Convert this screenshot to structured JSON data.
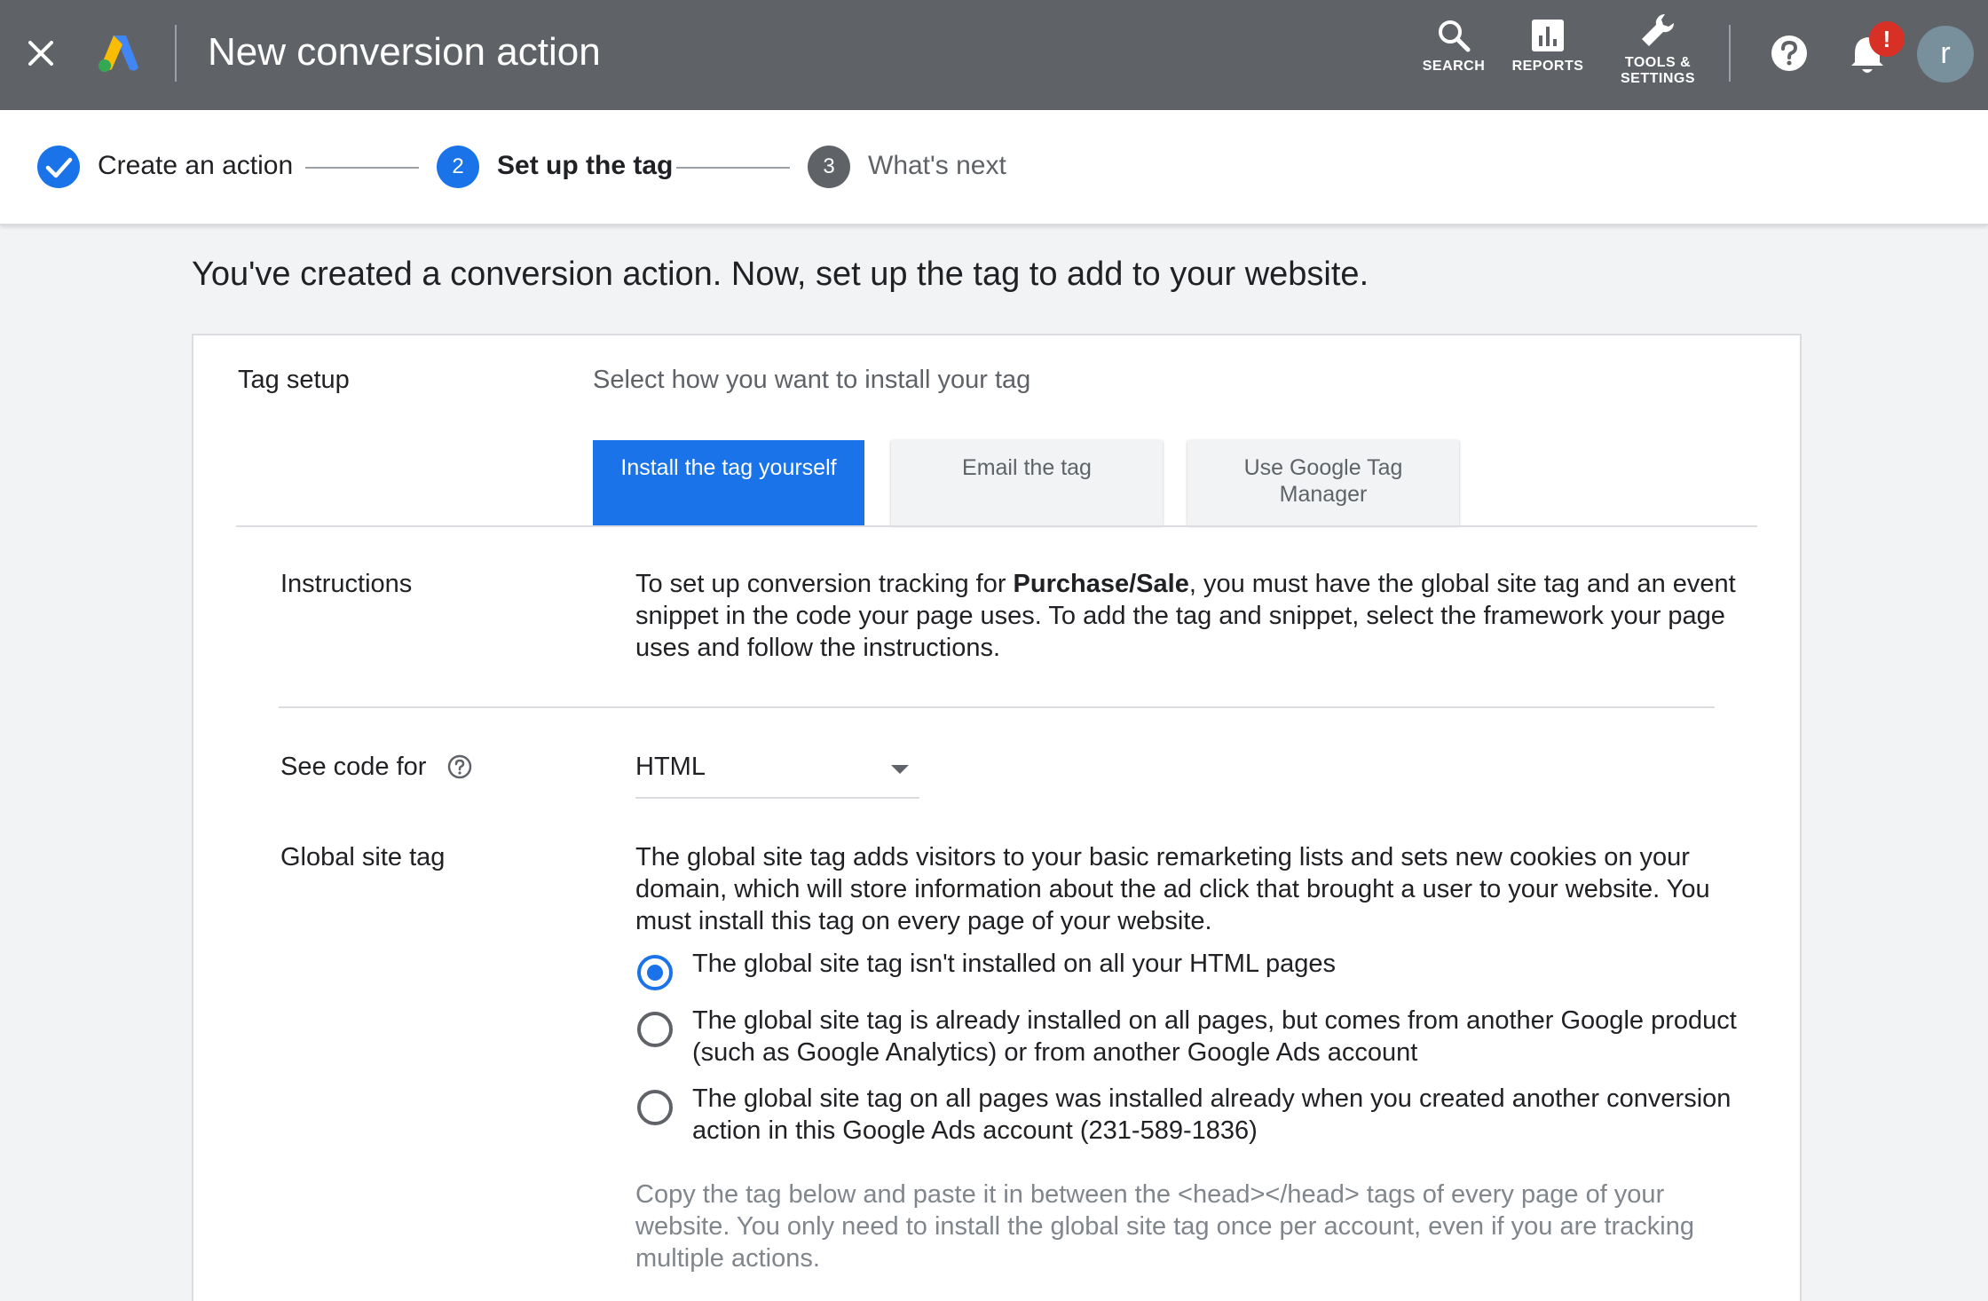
{
  "header": {
    "title": "New conversion action",
    "search_label": "SEARCH",
    "reports_label": "REPORTS",
    "tools_label_1": "TOOLS &",
    "tools_label_2": "SETTINGS",
    "notification_badge": "!",
    "avatar_initial": "r"
  },
  "stepper": {
    "steps": [
      {
        "label": "Create an action",
        "state": "done"
      },
      {
        "number": "2",
        "label": "Set up the tag",
        "state": "active"
      },
      {
        "number": "3",
        "label": "What's next",
        "state": "upcoming"
      }
    ]
  },
  "main": {
    "heading": "You've created a conversion action. Now, set up the tag to add to your website."
  },
  "tag_setup": {
    "label": "Tag setup",
    "hint": "Select how you want to install your tag",
    "tabs": [
      {
        "label": "Install the tag yourself",
        "active": true
      },
      {
        "label": "Email the tag",
        "active": false
      },
      {
        "label_line1": "Use Google Tag",
        "label_line2": "Manager",
        "active": false
      }
    ]
  },
  "instructions": {
    "label": "Instructions",
    "text_before": "To set up conversion tracking for ",
    "text_bold": "Purchase/Sale",
    "text_after": ", you must have the global site tag and an event snippet in the code your page uses. To add the tag and snippet, select the framework your page uses and follow the instructions."
  },
  "see_code_for": {
    "label": "See code for",
    "value": "HTML"
  },
  "global_site_tag": {
    "label": "Global site tag",
    "description": "The global site tag adds visitors to your basic remarketing lists and sets new cookies on your domain, which will store information about the ad click that brought a user to your website. You must install this tag on every page of your website.",
    "options": [
      {
        "label": "The global site tag isn't installed on all your HTML pages",
        "selected": true
      },
      {
        "label": "The global site tag is already installed on all pages, but comes from another Google product (such as Google Analytics) or from another Google Ads account",
        "selected": false
      },
      {
        "label": "The global site tag on all pages was installed already when you created another conversion action in this Google Ads account (231-589-1836)",
        "selected": false
      }
    ],
    "copy_note": "Copy the tag below and paste it in between the <head></head> tags of every page of your website. You only need to install the global site tag once per account, even if you are tracking multiple actions."
  },
  "colors": {
    "topbar": "#5f6368",
    "primary": "#1a73e8",
    "badge": "#d93025",
    "avatar": "#78909c"
  },
  "icons": {
    "close": "close-icon",
    "logo": "google-ads-logo",
    "search": "search-icon",
    "reports": "bar-chart-icon",
    "tools": "wrench-icon",
    "help": "help-icon",
    "notifications": "bell-icon"
  }
}
